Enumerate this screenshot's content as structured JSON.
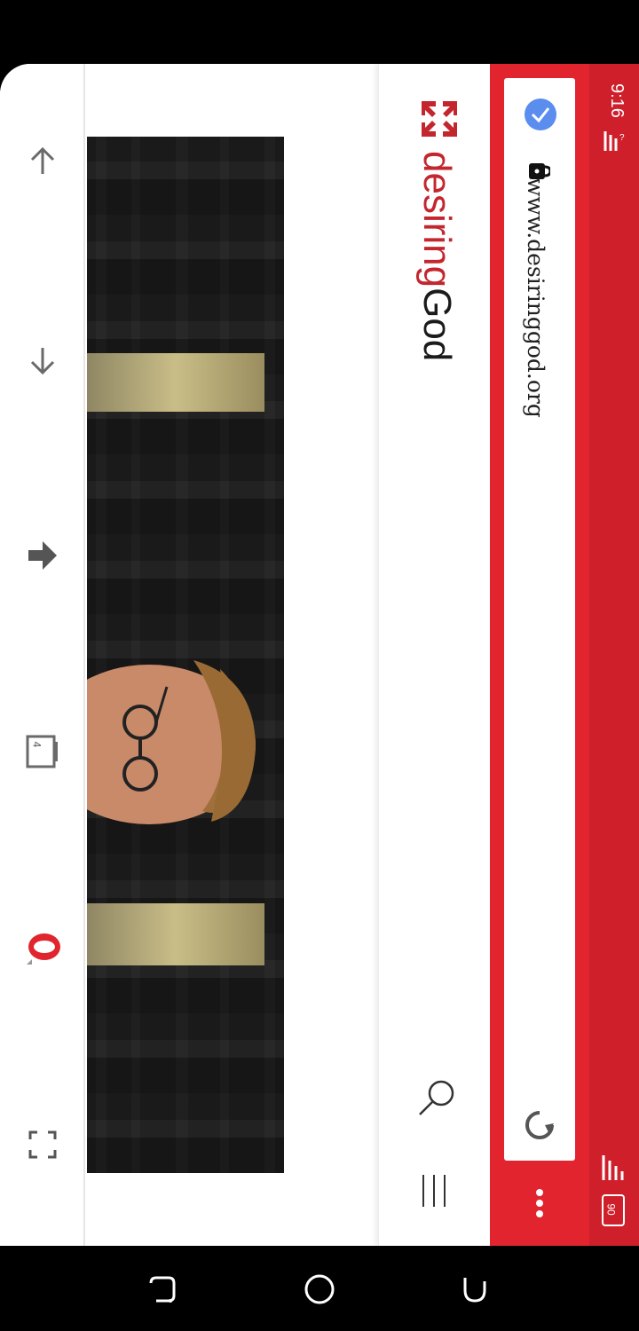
{
  "status_bar": {
    "time": "9:16",
    "battery": "90"
  },
  "browser": {
    "url": "www.desiringgod.org",
    "accent": "#e2242f"
  },
  "site": {
    "logo_part1": "desiring",
    "logo_part2": "God",
    "brand_color": "#c4262e"
  },
  "toolbar": {
    "tab_count": "4"
  },
  "icons": [
    "up-arrow-icon",
    "down-arrow-icon",
    "forward-icon",
    "tabs-icon",
    "opera-icon",
    "fullscreen-icon",
    "search-icon",
    "menu-icon",
    "reload-icon",
    "more-icon",
    "lock-icon",
    "vpn-icon",
    "wifi-icon",
    "signal-icon",
    "battery-icon"
  ]
}
